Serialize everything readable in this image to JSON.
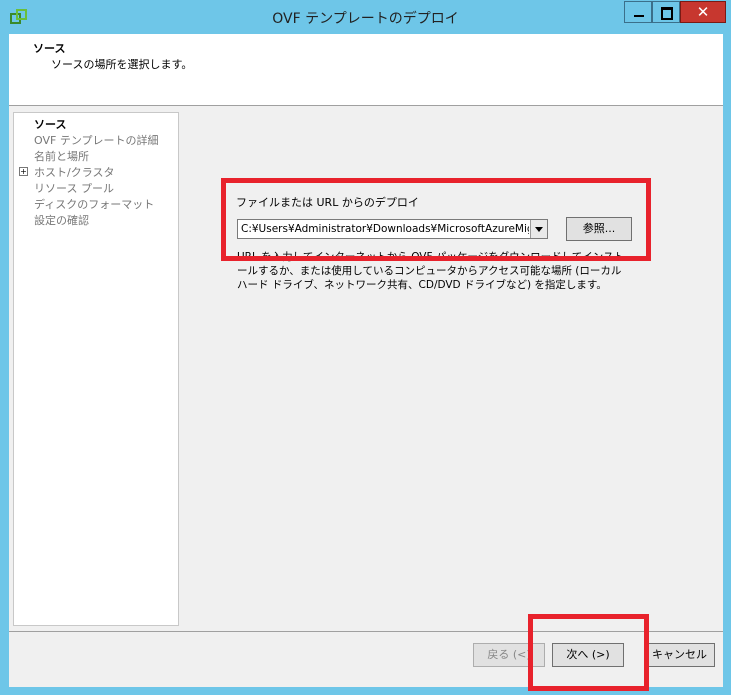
{
  "window": {
    "title": "OVF テンプレートのデプロイ",
    "close_glyph": "✕"
  },
  "header": {
    "title": "ソース",
    "subtitle": "ソースの場所を選択します。"
  },
  "nav": {
    "items": [
      {
        "label": "ソース",
        "active": true
      },
      {
        "label": "OVF テンプレートの詳細",
        "active": false
      },
      {
        "label": "名前と場所",
        "active": false
      },
      {
        "label": "ホスト/クラスタ",
        "active": false,
        "expandable": true
      },
      {
        "label": "リソース プール",
        "active": false
      },
      {
        "label": "ディスクのフォーマット",
        "active": false
      },
      {
        "label": "設定の確認",
        "active": false
      }
    ],
    "expand_glyph": "+"
  },
  "content": {
    "section_title": "ファイルまたは URL からのデプロイ",
    "path_value": "C:¥Users¥Administrator¥Downloads¥MicrosoftAzureMigration",
    "browse_label": "参照...",
    "description": "URL を入力してインターネットから OVF パッケージをダウンロードしてインストールするか、または使用しているコンピュータからアクセス可能な場所 (ローカル ハード ドライブ、ネットワーク共有、CD/DVD ドライブなど) を指定します。"
  },
  "footer": {
    "back_label": "戻る (<)",
    "next_label": "次へ (>)",
    "cancel_label": "キャンセル"
  },
  "colors": {
    "titlebar": "#6ec6e8",
    "highlight": "#e8222c",
    "close_button": "#c7372f"
  }
}
